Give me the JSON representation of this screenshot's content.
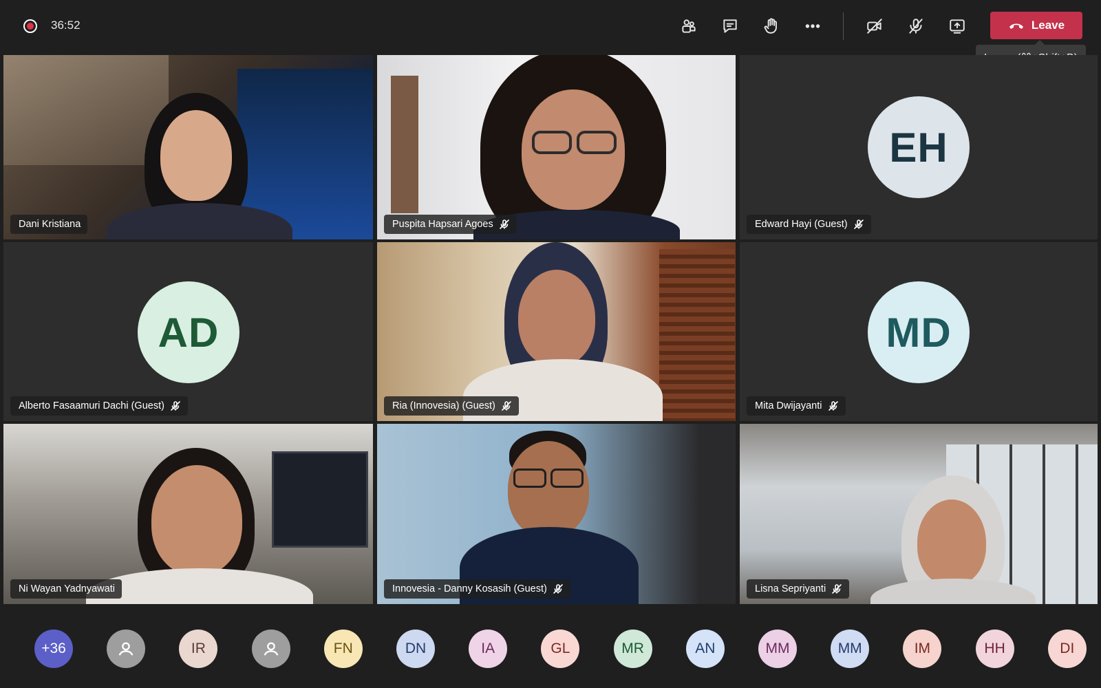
{
  "top_bar": {
    "recording": true,
    "timer": "36:52",
    "actions": [
      {
        "name": "people",
        "icon": "people-icon"
      },
      {
        "name": "chat",
        "icon": "chat-icon"
      },
      {
        "name": "raise-hand",
        "icon": "raise-hand-icon"
      },
      {
        "name": "more",
        "icon": "more-icon"
      },
      {
        "name": "camera",
        "icon": "camera-off-icon"
      },
      {
        "name": "mic",
        "icon": "mic-off-icon"
      },
      {
        "name": "share",
        "icon": "share-screen-icon"
      }
    ],
    "leave_label": "Leave",
    "leave_tooltip": "Leave (⌘+Shift+B)",
    "leave_color": "#c4314b"
  },
  "tiles": [
    {
      "name": "Dani Kristiana",
      "muted": false,
      "video": true
    },
    {
      "name": "Puspita Hapsari Agoes",
      "muted": true,
      "video": true
    },
    {
      "name": "Edward Hayi (Guest)",
      "muted": true,
      "video": false,
      "initials": "EH"
    },
    {
      "name": "Alberto Fasaamuri Dachi (Guest)",
      "muted": true,
      "video": false,
      "initials": "AD"
    },
    {
      "name": "Ria (Innovesia) (Guest)",
      "muted": true,
      "video": true
    },
    {
      "name": "Mita Dwijayanti",
      "muted": true,
      "video": false,
      "initials": "MD"
    },
    {
      "name": "Ni Wayan Yadnyawati",
      "muted": false,
      "video": true
    },
    {
      "name": "Innovesia - Danny Kosasih (Guest)",
      "muted": true,
      "video": true
    },
    {
      "name": "Lisna Sepriyanti",
      "muted": true,
      "video": true
    }
  ],
  "participants_bar": [
    {
      "label": "+36",
      "bg": "#5b5fc7",
      "fg": "#ffffff"
    },
    {
      "label": "",
      "icon": "person-icon",
      "bg": "#9e9e9e",
      "fg": "#ffffff"
    },
    {
      "label": "IR",
      "bg": "#ead7d0",
      "fg": "#5a3d33"
    },
    {
      "label": "",
      "icon": "person-icon",
      "bg": "#9e9e9e",
      "fg": "#ffffff"
    },
    {
      "label": "FN",
      "bg": "#f8e7b4",
      "fg": "#6b5210"
    },
    {
      "label": "DN",
      "bg": "#cdd9f0",
      "fg": "#243a6b"
    },
    {
      "label": "IA",
      "bg": "#efd4e8",
      "fg": "#6b2a5c"
    },
    {
      "label": "GL",
      "bg": "#f9d8d4",
      "fg": "#7a2a22"
    },
    {
      "label": "MR",
      "bg": "#cfe8d8",
      "fg": "#1d5a35"
    },
    {
      "label": "AN",
      "bg": "#d4e3f7",
      "fg": "#1f3e6e"
    },
    {
      "label": "MM",
      "bg": "#ecd0e6",
      "fg": "#6b2a5c"
    },
    {
      "label": "MM",
      "bg": "#cfdcf3",
      "fg": "#243a6b"
    },
    {
      "label": "IM",
      "bg": "#f6d3cc",
      "fg": "#7a2a22"
    },
    {
      "label": "HH",
      "bg": "#f2d4dc",
      "fg": "#6e2536"
    },
    {
      "label": "DI",
      "bg": "#f7d6d3",
      "fg": "#7a2a22"
    }
  ]
}
